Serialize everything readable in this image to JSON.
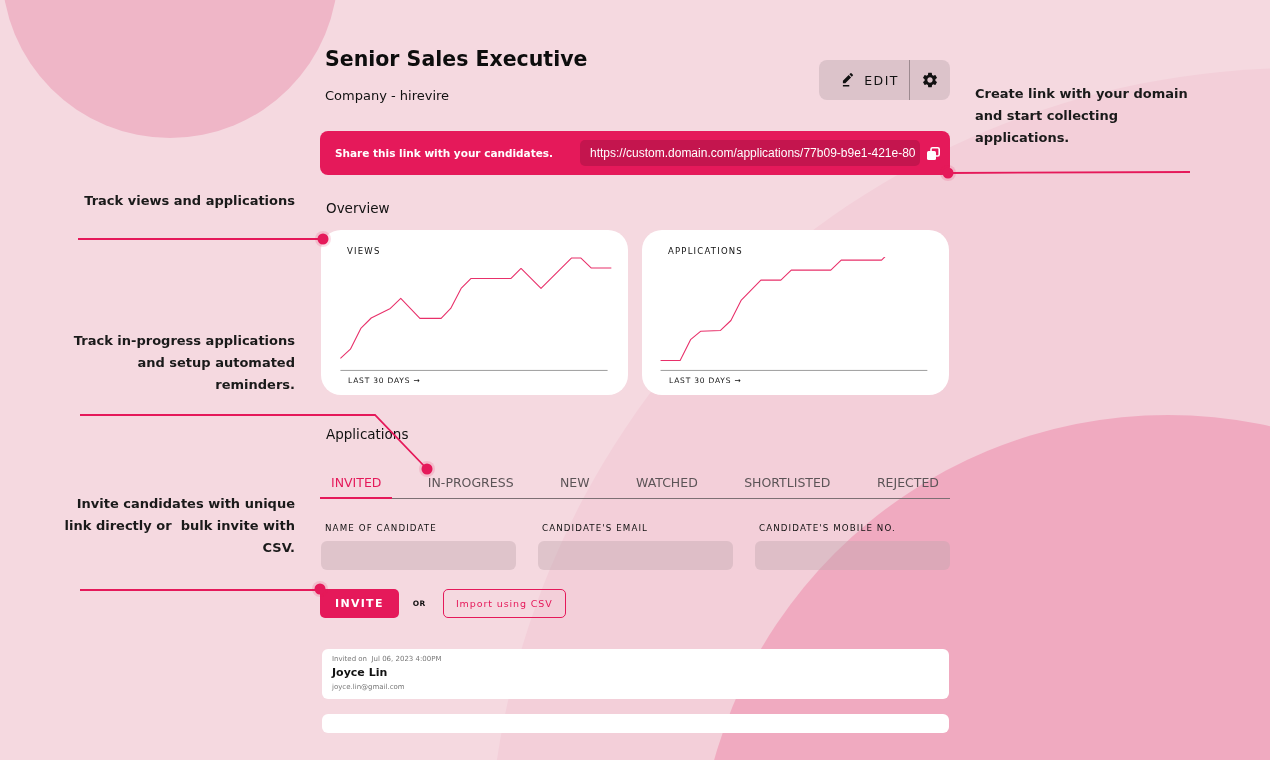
{
  "job": {
    "title": "Senior Sales Executive",
    "company": "Company - hirevire"
  },
  "actions": [
    {
      "kind": "edit",
      "label": "EDIT"
    },
    {
      "kind": "settings"
    }
  ],
  "share": {
    "label": "Share this link with your candidates.",
    "url": "https://custom.domain.com/applications/77b09-b9e1-421e-80"
  },
  "overview": {
    "heading": "Overview",
    "cards": [
      {
        "title": "VIEWS",
        "footer": "LAST 30 DAYS →"
      },
      {
        "title": "APPLICATIONS",
        "footer": "LAST 30 DAYS →"
      }
    ]
  },
  "applications": {
    "heading": "Applications",
    "tabs": [
      {
        "label": "INVITED",
        "selected": true
      },
      {
        "label": "IN-PROGRESS",
        "selected": false
      },
      {
        "label": "NEW",
        "selected": false
      },
      {
        "label": "WATCHED",
        "selected": false
      },
      {
        "label": "SHORTLISTED",
        "selected": false
      },
      {
        "label": "REJECTED",
        "selected": false
      }
    ],
    "fields": [
      {
        "label": "NAME OF CANDIDATE"
      },
      {
        "label": "CANDIDATE'S EMAIL"
      },
      {
        "label": "CANDIDATE'S MOBILE NO."
      }
    ],
    "invite_button": "INVITE",
    "separator": "OR",
    "import_button": "Import using CSV",
    "invites": [
      {
        "kind": "entry",
        "invited_on": "Invited on  Jul 06, 2023 4:00PM",
        "name": "Joyce Lin",
        "email": "joyce.lin@gmail.com"
      },
      {
        "kind": "placeholder"
      }
    ]
  },
  "callouts": {
    "left": [
      "Track views and applications",
      "Track in-progress applications\nand setup automated\nreminders.",
      "Invite candidates with unique\nlink directly or  bulk invite with\nCSV."
    ],
    "right": [
      "Create link with your domain\nand start collecting\napplications."
    ]
  }
}
